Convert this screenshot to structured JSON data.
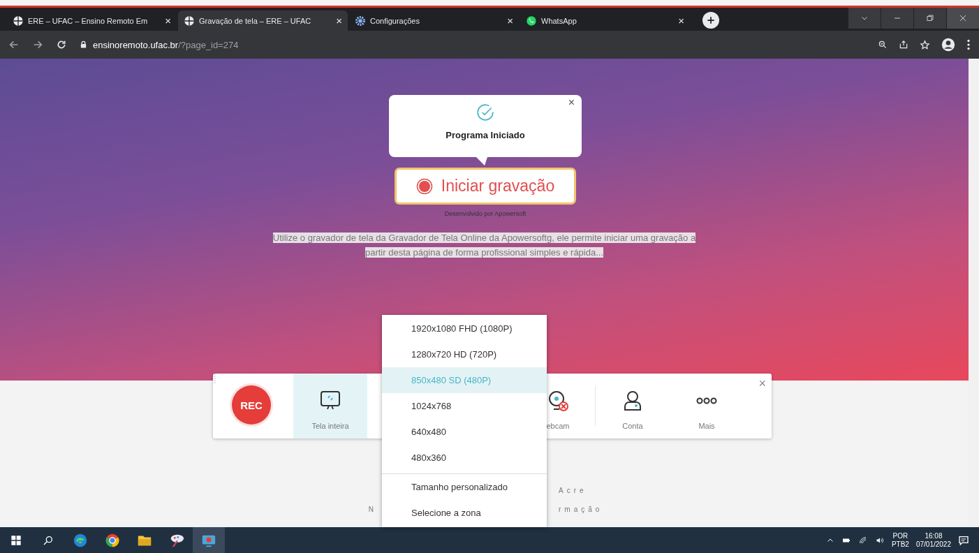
{
  "tabs": [
    {
      "kind": "globe",
      "title": "ERE – UFAC – Ensino Remoto Em",
      "close": "×",
      "selected": false
    },
    {
      "kind": "globe",
      "title": "Gravação de tela – ERE – UFAC",
      "close": "×",
      "selected": true
    },
    {
      "kind": "gear",
      "title": "Configurações",
      "close": "×",
      "selected": false
    },
    {
      "kind": "chat",
      "title": "WhatsApp",
      "close": "×",
      "selected": false
    }
  ],
  "address_bar": {
    "host": "ensinoremoto.ufac.br",
    "path": "/?page_id=274"
  },
  "callout": {
    "title": "Programa Iniciado",
    "close": "×"
  },
  "start_button": {
    "label": "Iniciar gravação"
  },
  "credit": "Desenvolvido por Apowersoft",
  "description": "Utilize o gravador de tela da Gravador de Tela Online da Apowersoftg, ele permite iniciar uma gravação a partir desta página de forma profissional simples e rápida...",
  "recorder_toolbar": {
    "rec_label": "REC",
    "close": "×",
    "tools": [
      {
        "kind": "fullscreen",
        "label": "Tela inteira",
        "selected": true
      },
      {
        "kind": "webcam",
        "label": "ebcam",
        "selected": false
      },
      {
        "kind": "account",
        "label": "Conta",
        "selected": false
      },
      {
        "kind": "more",
        "label": "Mais",
        "selected": false
      }
    ]
  },
  "size_menu": {
    "sizes": [
      {
        "label": "1920x1080 FHD (1080P)",
        "selected": false
      },
      {
        "label": "1280x720 HD (720P)",
        "selected": false
      },
      {
        "label": "850x480 SD (480P)",
        "selected": true
      },
      {
        "label": "1024x768",
        "selected": false
      },
      {
        "label": "640x480",
        "selected": false
      },
      {
        "label": "480x360",
        "selected": false
      }
    ],
    "extras": [
      {
        "label": "Tamanho personalizado",
        "selected": false
      },
      {
        "label": "Selecione a zona",
        "selected": false
      }
    ]
  },
  "footer": {
    "line_1_right": "Acre",
    "line_2_left": "N",
    "line_2_right": "rmação"
  },
  "taskbar": {
    "apps": [
      {
        "kind": "swirl",
        "active": false
      },
      {
        "kind": "ring",
        "active": false
      },
      {
        "kind": "folder",
        "active": false
      },
      {
        "kind": "palette",
        "active": false
      },
      {
        "kind": "camera",
        "active": true
      }
    ],
    "language": "POR",
    "layout": "PTB2",
    "time": "16:08",
    "date": "07/01/2022"
  }
}
